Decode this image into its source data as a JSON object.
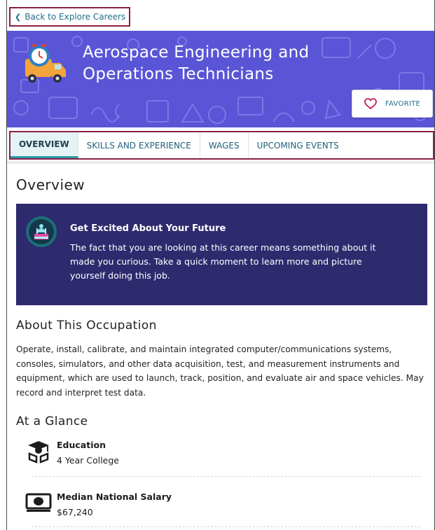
{
  "nav": {
    "back_label": "Back to Explore Careers"
  },
  "hero": {
    "title": "Aerospace Engineering and Operations Technicians",
    "favorite_label": "FAVORITE",
    "bg_color": "#5a55d6"
  },
  "tabs": [
    {
      "label": "OVERVIEW",
      "active": true
    },
    {
      "label": "SKILLS AND EXPERIENCE",
      "active": false
    },
    {
      "label": "WAGES",
      "active": false
    },
    {
      "label": "UPCOMING EVENTS",
      "active": false
    }
  ],
  "overview": {
    "heading": "Overview",
    "callout": {
      "title": "Get Excited About Your Future",
      "body": "The fact that you are looking at this career means something about it made you curious. Take a quick moment to learn more and picture yourself doing this job."
    },
    "about_heading": "About This Occupation",
    "about_text": "Operate, install, calibrate, and maintain integrated computer/communications systems, consoles, simulators, and other data acquisition, test, and measurement instruments and equipment, which are used to launch, track, position, and evaluate air and space vehicles. May record and interpret test data.",
    "glance_heading": "At a Glance",
    "glance": [
      {
        "icon": "graduation-icon",
        "title": "Education",
        "value": "4 Year College"
      },
      {
        "icon": "money-icon",
        "title": "Median National Salary",
        "value": "$67,240"
      }
    ]
  }
}
